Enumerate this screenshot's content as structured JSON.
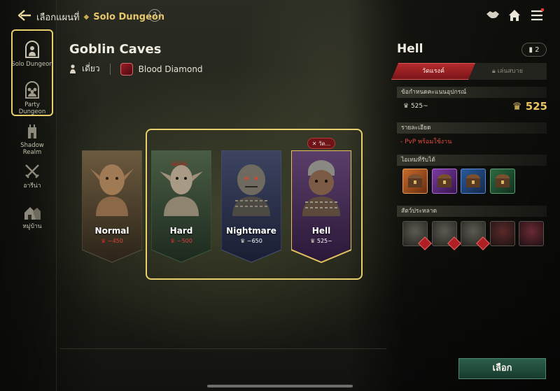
{
  "header": {
    "breadcrumb_root": "เลือกแผนที่",
    "breadcrumb_current": "Solo Dungeon",
    "help_label": "?"
  },
  "sidebar": {
    "items": [
      {
        "label": "Solo Dungeon",
        "icon": "solo-dungeon-icon",
        "selected": true
      },
      {
        "label": "Party Dungeon",
        "icon": "party-dungeon-icon",
        "selected": false
      },
      {
        "label": "Shadow Realm",
        "icon": "tower-icon",
        "selected": false
      },
      {
        "label": "อารีน่า",
        "icon": "crossed-swords-icon",
        "selected": false
      },
      {
        "label": "หมู่บ้าน",
        "icon": "village-icon",
        "selected": false
      }
    ]
  },
  "dungeon": {
    "title": "Goblin Caves",
    "mode": "เดี่ยว",
    "reward_name": "Blood Diamond"
  },
  "difficulties": [
    {
      "name": "Normal",
      "requirement": "~450",
      "meets": false
    },
    {
      "name": "Hard",
      "requirement": "~500",
      "meets": false
    },
    {
      "name": "Nightmare",
      "requirement": "~650",
      "meets": true
    },
    {
      "name": "Hell",
      "requirement": "525~",
      "meets": true,
      "selected": true,
      "tag": "✕ วัด..."
    }
  ],
  "detail": {
    "title": "Hell",
    "count": "2",
    "tab_active": "วัดแรงค์",
    "tab_inactive": "เล่นสบาย",
    "gear_header": "ข้อกำหนดคะแนนอุปกรณ์",
    "gear_requirement": "525~",
    "gear_current": "525",
    "details_header": "รายละเอียด",
    "details_line": "-  PvP พร้อมใช้งาน",
    "loot_header": "ไอเทมที่รับได้",
    "monsters_header": "สัตว์ประหลาด"
  },
  "actions": {
    "select_label": "เลือก"
  },
  "colors": {
    "accent_gold": "#e8cf6c",
    "danger_red": "#b42a2c",
    "select_green": "#2c5e4a"
  }
}
